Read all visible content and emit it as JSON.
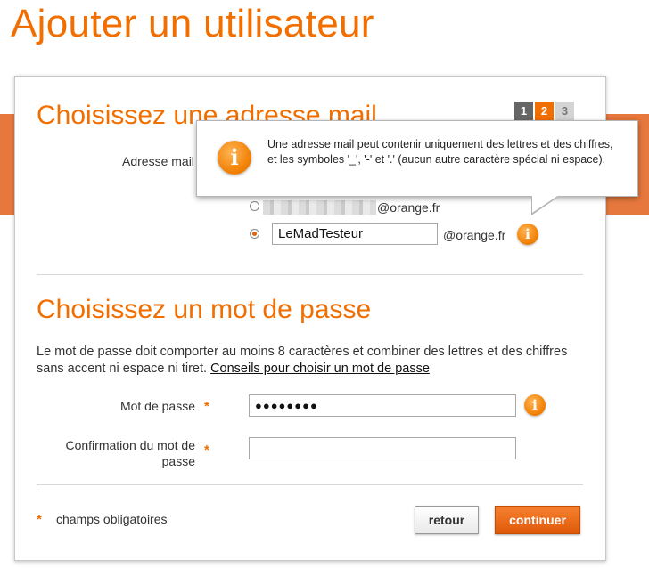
{
  "page": {
    "title": "Ajouter un utilisateur"
  },
  "steps": [
    {
      "label": "1",
      "state": "done"
    },
    {
      "label": "2",
      "state": "active"
    },
    {
      "label": "3",
      "state": "todo"
    }
  ],
  "email_section": {
    "title": "Choisissez une adresse mail",
    "label": "Adresse mail",
    "option_existing_domain": "@orange.fr",
    "option_custom_value": "LeMadTesteur",
    "option_custom_domain": "@orange.fr"
  },
  "tooltip": {
    "text": "Une adresse mail peut contenir uniquement des lettres et des chiffres, et les symboles '_', '-' et '.' (aucun autre caractère spécial ni espace)."
  },
  "password_section": {
    "title": "Choisissez un mot de passe",
    "description": "Le mot de passe doit comporter au moins 8 caractères et combiner des lettres et des chiffres sans accent ni espace ni tiret.",
    "tips_link": "Conseils pour choisir un mot de passe",
    "password_label": "Mot de passe",
    "password_value": "●●●●●●●●",
    "confirm_label": "Confirmation du mot de passe",
    "confirm_value": ""
  },
  "footer": {
    "required_star": "*",
    "required_note": "champs obligatoires",
    "back_label": "retour",
    "continue_label": "continuer"
  },
  "info_glyph": "i",
  "colors": {
    "accent": "#f16e00",
    "band": "#e6783e"
  }
}
